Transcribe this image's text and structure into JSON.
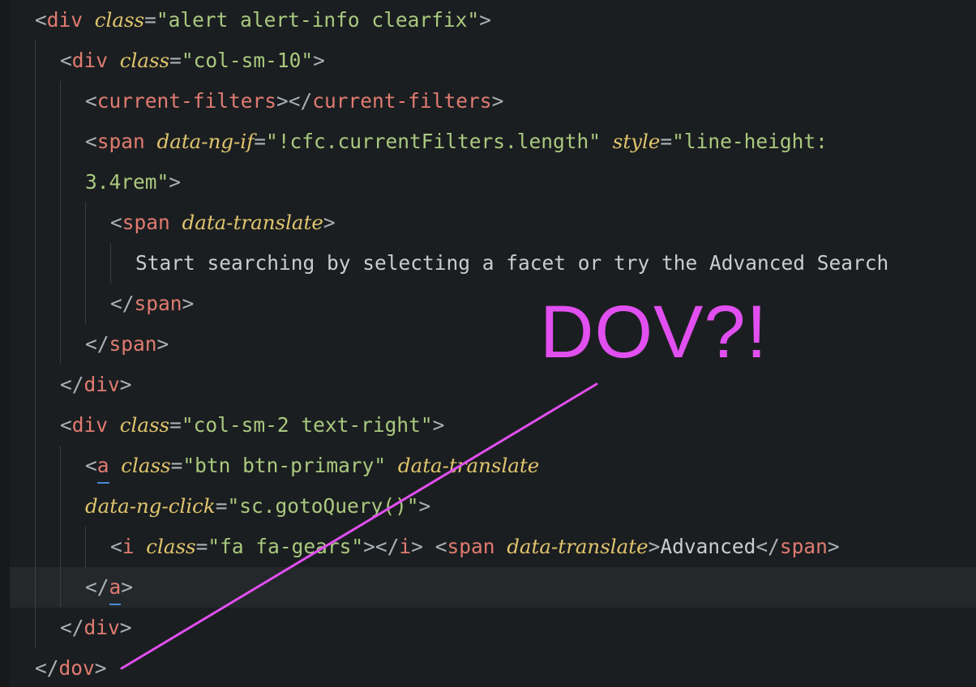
{
  "code": {
    "l1": {
      "tag": "div",
      "attr": "class",
      "val": "\"alert alert-info clearfix\""
    },
    "l2": {
      "tag": "div",
      "attr": "class",
      "val": "\"col-sm-10\""
    },
    "l3": {
      "open": "current-filters",
      "close": "current-filters"
    },
    "l4": {
      "tag": "span",
      "attr1": "data-ng-if",
      "val1": "\"!cfc.currentFilters.length\"",
      "attr2": "style",
      "val2_part1": "\"line-height:"
    },
    "l5": {
      "val2_part2": "3.4rem\""
    },
    "l6": {
      "tag": "span",
      "attr": "data-translate"
    },
    "l7": {
      "text": "Start searching by selecting a facet or try the Advanced Search"
    },
    "l8": {
      "tag": "span"
    },
    "l9": {
      "tag": "span"
    },
    "l10": {
      "tag": "div"
    },
    "l11": {
      "tag": "div",
      "attr": "class",
      "val": "\"col-sm-2 text-right\""
    },
    "l12": {
      "tag": "a",
      "attr1": "class",
      "val1": "\"btn btn-primary\"",
      "attr2": "data-translate"
    },
    "l13": {
      "attr": "data-ng-click",
      "val": "\"sc.gotoQuery()\""
    },
    "l14": {
      "tag_i": "i",
      "attr": "class",
      "val": "\"fa fa-gears\"",
      "tag_span": "span",
      "attr2": "data-translate",
      "text": "Advanced"
    },
    "l15": {
      "tag": "a"
    },
    "l16": {
      "tag": "div"
    },
    "l17": {
      "tag": "dov"
    }
  },
  "annotation": {
    "text": "DOV?!",
    "color": "#e14ff0"
  },
  "colors": {
    "background": "#1b1e20",
    "tag": "#e07b71",
    "attribute": "#e0c56e",
    "string": "#a9c97f",
    "punctuation": "#aab1b6"
  }
}
